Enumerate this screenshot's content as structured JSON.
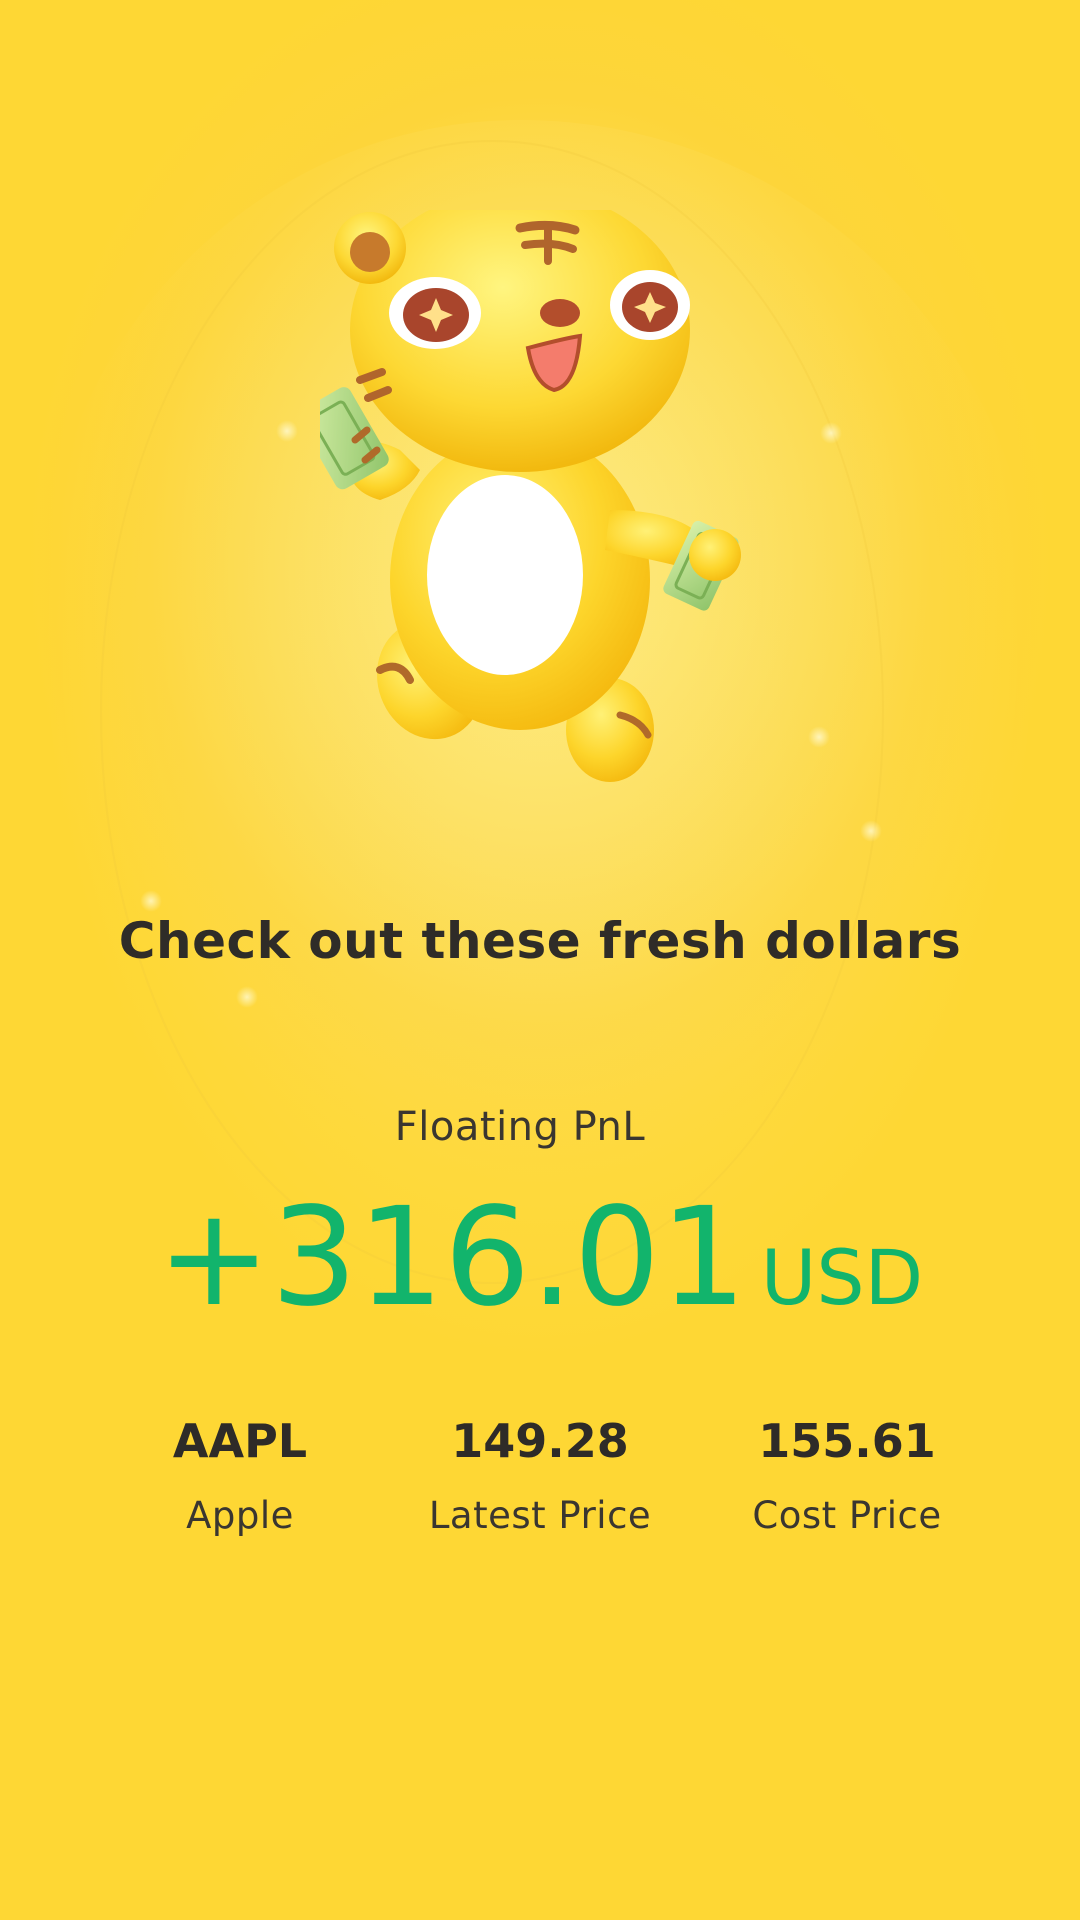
{
  "headline": "Check out these fresh dollars",
  "pnl": {
    "label": "Floating PnL",
    "value": "+316.01",
    "currency": "USD"
  },
  "stats": [
    {
      "value": "AAPL",
      "label": "Apple"
    },
    {
      "value": "149.28",
      "label": "Latest Price"
    },
    {
      "value": "155.61",
      "label": "Cost Price"
    }
  ],
  "colors": {
    "background": "#fed734",
    "profit": "#12b46c",
    "text": "#2e2b28"
  },
  "illustration": "tiger-mascot-holding-cash"
}
